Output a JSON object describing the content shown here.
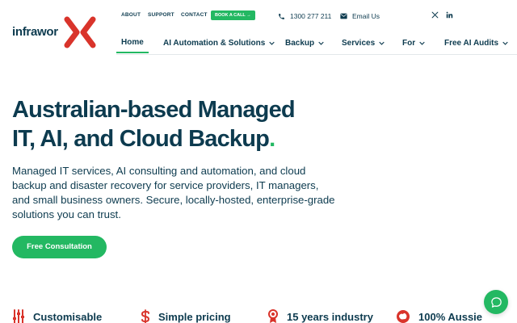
{
  "brand": {
    "name": "infrawor",
    "primary_color": "#0d3b4f",
    "accent_color": "#23b862",
    "logo_color": "#d9342b"
  },
  "topbar": {
    "about": "ABOUT",
    "support": "SUPPORT",
    "contact": "CONTACT",
    "book_call": "BOOK A CALL →",
    "phone": "1300 277 211",
    "email": "Email Us",
    "social": [
      "x-icon",
      "linkedin-icon"
    ]
  },
  "nav": {
    "items": [
      {
        "label": "Home",
        "active": true,
        "dropdown": false
      },
      {
        "label": "AI Automation & Solutions",
        "active": false,
        "dropdown": true
      },
      {
        "label": "Backup",
        "active": false,
        "dropdown": true
      },
      {
        "label": "Services",
        "active": false,
        "dropdown": true
      },
      {
        "label": "For",
        "active": false,
        "dropdown": true
      },
      {
        "label": "Free AI Audits",
        "active": false,
        "dropdown": true
      }
    ]
  },
  "hero": {
    "title_line1": "Australian-based Managed",
    "title_line2": "IT, AI, and Cloud Backup",
    "title_dot": ".",
    "description": "Managed IT services, AI consulting and automation, and cloud backup and disaster recovery for service providers, IT managers, and small business owners. Secure, locally-hosted, enterprise-grade solutions you can trust.",
    "cta": "Free Consultation"
  },
  "features": [
    {
      "icon": "sliders-icon",
      "label": "Customisable"
    },
    {
      "icon": "dollar-icon",
      "label": "Simple pricing"
    },
    {
      "icon": "award-icon",
      "label": "15 years industry"
    },
    {
      "icon": "australia-icon",
      "label": "100% Aussie"
    }
  ],
  "chat": {
    "icon": "chat-icon"
  }
}
